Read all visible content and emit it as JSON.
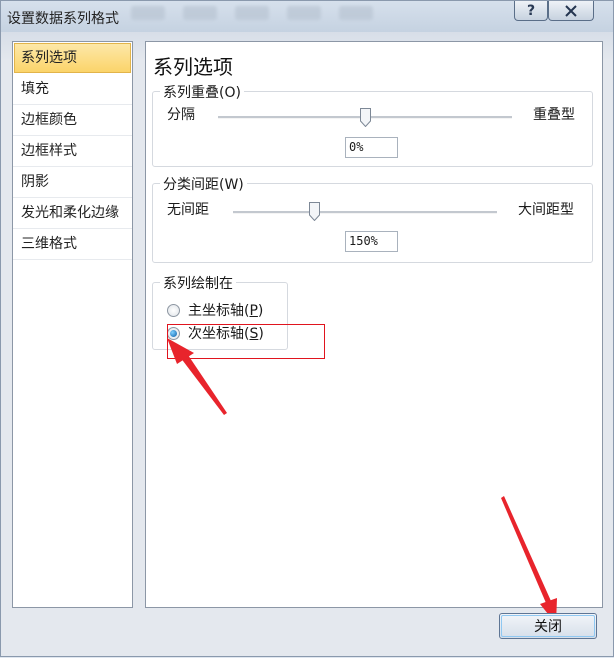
{
  "window": {
    "title": "设置数据系列格式",
    "help_label": "?"
  },
  "nav": {
    "items": [
      {
        "label": "系列选项",
        "selected": true
      },
      {
        "label": "填充",
        "selected": false
      },
      {
        "label": "边框颜色",
        "selected": false
      },
      {
        "label": "边框样式",
        "selected": false
      },
      {
        "label": "阴影",
        "selected": false
      },
      {
        "label": "发光和柔化边缘",
        "selected": false
      },
      {
        "label": "三维格式",
        "selected": false
      }
    ]
  },
  "content": {
    "title": "系列选项",
    "overlap": {
      "label": "系列重叠(O)",
      "left": "分隔",
      "right": "重叠型",
      "value": "0%"
    },
    "gap": {
      "label": "分类间距(W)",
      "left": "无间距",
      "right": "大间距型",
      "value": "150%"
    },
    "plot_on": {
      "label": "系列绘制在",
      "options": [
        {
          "label_main": "主坐标轴(",
          "key": "P",
          "label_end": ")",
          "checked": false
        },
        {
          "label_main": "次坐标轴(",
          "key": "S",
          "label_end": ")",
          "checked": true
        }
      ]
    }
  },
  "footer": {
    "close_label": "关闭"
  },
  "colors": {
    "annotation": "#e0141e",
    "selected_nav": "#fbd46a"
  }
}
